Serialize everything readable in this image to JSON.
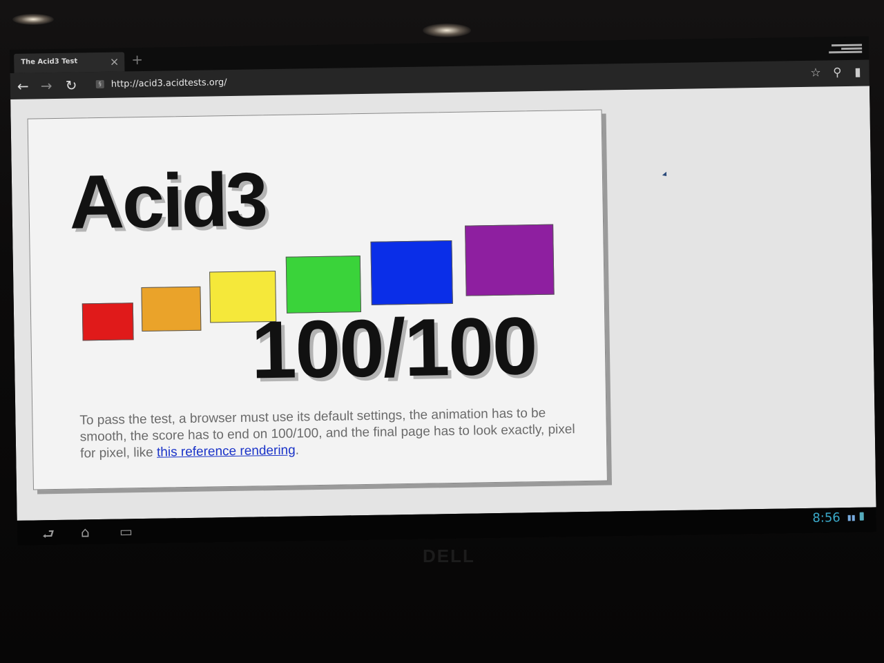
{
  "browser": {
    "tab_title": "The Acid3 Test",
    "tab_close": "×",
    "new_tab": "+",
    "url": "http://acid3.acidtests.org/",
    "favicon_glyph": "§",
    "nav": {
      "back": "←",
      "forward": "→",
      "reload": "↻"
    },
    "toolbar_icons": {
      "star": "☆",
      "search": "⚲",
      "bookmarks": "▮"
    }
  },
  "page": {
    "title": "Acid3",
    "score": "100/100",
    "description_text": "To pass the test, a browser must use its default settings, the animation has to be smooth, the score has to end on 100/100, and the final page has to look exactly, pixel for pixel, like ",
    "link_text": "this reference rendering",
    "description_end": ".",
    "squares": [
      {
        "color": "#e01a1a"
      },
      {
        "color": "#eaa32a"
      },
      {
        "color": "#f5e83a"
      },
      {
        "color": "#3ad33a"
      },
      {
        "color": "#0a2ee8"
      },
      {
        "color": "#8e1fa0"
      }
    ]
  },
  "system_bar": {
    "back": "⮐",
    "home": "⌂",
    "recents": "▭",
    "clock": "8:56",
    "status_icon": "▮▮"
  },
  "monitor": {
    "brand": "DELL"
  }
}
